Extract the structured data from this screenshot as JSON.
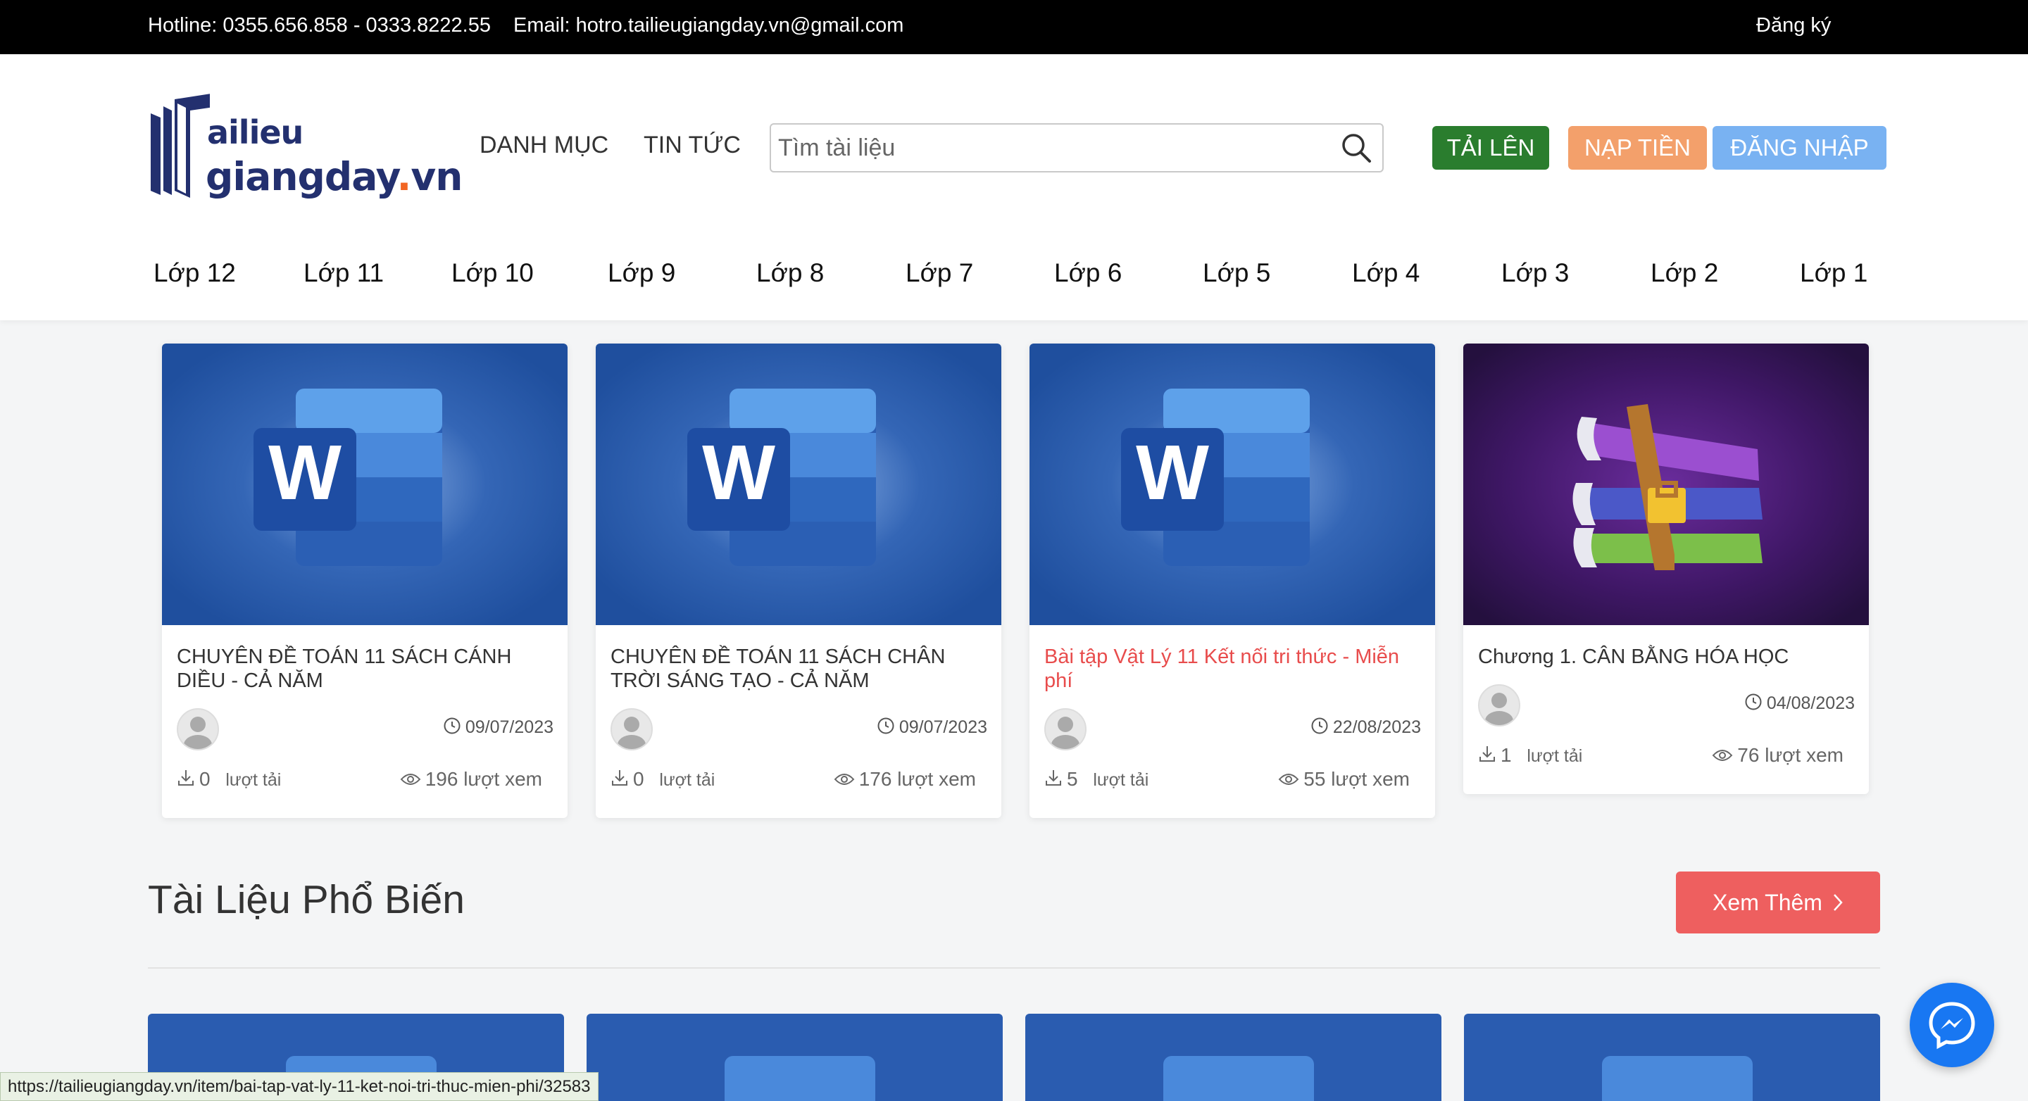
{
  "topbar": {
    "hotline": "Hotline: 0355.656.858 - 0333.8222.55",
    "email": "Email: hotro.tailieugiangday.vn@gmail.com",
    "signup": "Đăng ký"
  },
  "logo": {
    "line1": "ailieu",
    "line2": "giangday",
    "line2_dot": ".",
    "line2_end": "vn"
  },
  "nav": {
    "category": "DANH MỤC",
    "news": "TIN TỨC"
  },
  "search": {
    "placeholder": "Tìm tài liệu",
    "value": ""
  },
  "buttons": {
    "upload": "TẢI LÊN",
    "topup": "NẠP TIỀN",
    "login": "ĐĂNG NHẬP"
  },
  "grades": [
    "Lớp 12",
    "Lớp 11",
    "Lớp 10",
    "Lớp 9",
    "Lớp 8",
    "Lớp 7",
    "Lớp 6",
    "Lớp 5",
    "Lớp 4",
    "Lớp 3",
    "Lớp 2",
    "Lớp 1"
  ],
  "cards": [
    {
      "title": "CHUYÊN ĐỀ TOÁN 11 SÁCH CÁNH DIỀU - CẢ NĂM",
      "date": "09/07/2023",
      "downloads": "0",
      "downloads_label": "lượt tải",
      "views": "196 lượt xem",
      "thumb": "word-icon"
    },
    {
      "title": "CHUYÊN ĐỀ TOÁN 11 SÁCH CHÂN TRỜI SÁNG TẠO - CẢ NĂM",
      "date": "09/07/2023",
      "downloads": "0",
      "downloads_label": "lượt tải",
      "views": "176 lượt xem",
      "thumb": "word-icon"
    },
    {
      "title": "Bài tập Vật Lý 11 Kết nối tri thức - Miễn phí",
      "date": "22/08/2023",
      "downloads": "5",
      "downloads_label": "lượt tải",
      "views": "55 lượt xem",
      "thumb": "word-icon",
      "highlight_color": "#e84c4c"
    },
    {
      "title": "Chương 1. CÂN BẰNG HÓA HỌC",
      "date": "04/08/2023",
      "downloads": "1",
      "downloads_label": "lượt tải",
      "views": "76 lượt xem",
      "thumb": "winrar-icon"
    }
  ],
  "section": {
    "title": "Tài Liệu Phổ Biến",
    "more": "Xem Thêm"
  },
  "statusbar": {
    "url": "https://tailieugiangday.vn/item/bai-tap-vat-ly-11-ket-noi-tri-thuc-mien-phi/32583"
  },
  "colors": {
    "upload": "#2a7d2e",
    "topup": "#f3a06b",
    "login": "#79b2f2",
    "more": "#ee5f5f",
    "brand": "#23306f",
    "messenger": "#1877f2"
  }
}
